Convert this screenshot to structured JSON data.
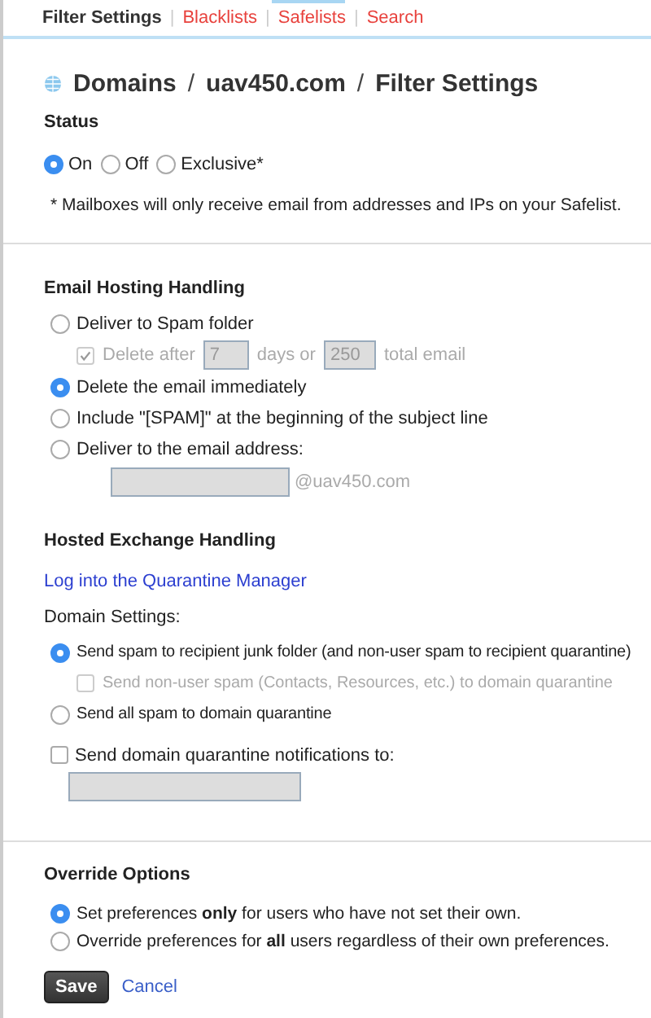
{
  "nav": [
    {
      "kind": "link",
      "label": "Filter Settings",
      "selected": true
    },
    {
      "kind": "separator",
      "label": "|"
    },
    {
      "kind": "link",
      "label": "Blacklists",
      "selected": false
    },
    {
      "kind": "separator",
      "label": "|"
    },
    {
      "kind": "link",
      "label": "Safelists",
      "selected": false
    },
    {
      "kind": "separator",
      "label": "|"
    },
    {
      "kind": "link",
      "label": "Search",
      "selected": false
    }
  ],
  "breadcrumb": [
    {
      "kind": "crumb",
      "text": "Domains"
    },
    {
      "kind": "separator",
      "text": "/"
    },
    {
      "kind": "crumb",
      "text": "uav450.com"
    },
    {
      "kind": "separator",
      "text": "/"
    },
    {
      "kind": "crumb",
      "text": "Filter Settings"
    }
  ],
  "status": {
    "heading": "Status",
    "options": [
      {
        "label": "On",
        "selected": true
      },
      {
        "label": "Off",
        "selected": false
      },
      {
        "label": "Exclusive*",
        "selected": false
      }
    ],
    "note": "* Mailboxes will only receive email from addresses and IPs on your Safelist."
  },
  "email_hosting": {
    "heading": "Email Hosting Handling",
    "options": [
      {
        "label": "Deliver to Spam folder",
        "selected": false,
        "detail": {
          "kind": "delete_after",
          "checked": true,
          "disabled": true,
          "label": "Delete after",
          "days": "7",
          "middle": "days or",
          "count": "250",
          "end": "total email"
        }
      },
      {
        "label": "Delete the email immediately",
        "selected": true
      },
      {
        "label": "Include \"[SPAM]\" at the beginning of the subject line",
        "selected": false
      },
      {
        "label": "Deliver to the email address:",
        "selected": false,
        "detail": {
          "kind": "address",
          "suffix": "@uav450.com"
        }
      }
    ]
  },
  "hosted_exchange": {
    "heading": "Hosted Exchange Handling",
    "link": "Log into the Quarantine Manager",
    "label": "Domain Settings:",
    "options": [
      {
        "kind": "radio",
        "label": "Send spam to recipient junk folder (and non-user spam to recipient quarantine)",
        "selected": true,
        "sub": {
          "label": "Send non-user spam (Contacts, Resources, etc.) to domain quarantine",
          "checked": false,
          "disabled": true
        }
      },
      {
        "kind": "radio",
        "label": "Send all spam to domain quarantine",
        "selected": false
      },
      {
        "kind": "checkbox",
        "label": "Send domain quarantine notifications to:",
        "checked": false,
        "field": true
      }
    ]
  },
  "override": {
    "heading": "Override Options",
    "options": [
      {
        "label": "Set preferences **only** for users who have not set their own.",
        "selected": true
      },
      {
        "label": "Override preferences for **all** users regardless of their own preferences.",
        "selected": false
      }
    ]
  },
  "buttons": {
    "save": "Save",
    "cancel": "Cancel"
  }
}
